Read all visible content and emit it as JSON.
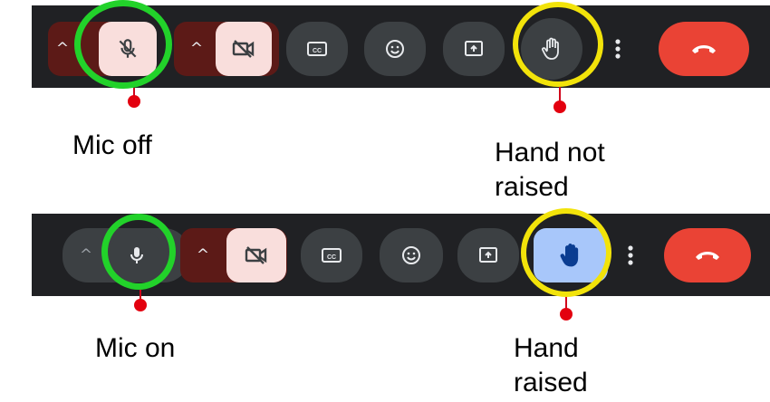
{
  "toolbar_top": {
    "mic": {
      "state": "off",
      "icon": "mic-off-icon"
    },
    "camera": {
      "state": "off",
      "icon": "camera-off-icon"
    },
    "captions": {
      "icon": "closed-captions-icon"
    },
    "reactions": {
      "icon": "emoji-icon"
    },
    "present": {
      "icon": "present-screen-icon"
    },
    "raise_hand": {
      "state": "not raised",
      "icon": "hand-icon"
    },
    "more": {
      "icon": "more-vert-icon"
    },
    "leave": {
      "icon": "end-call-icon",
      "color": "#ea4335"
    }
  },
  "toolbar_bottom": {
    "mic": {
      "state": "on",
      "icon": "mic-icon"
    },
    "camera": {
      "state": "off",
      "icon": "camera-off-icon"
    },
    "captions": {
      "icon": "closed-captions-icon"
    },
    "reactions": {
      "icon": "emoji-icon"
    },
    "present": {
      "icon": "present-screen-icon"
    },
    "raise_hand": {
      "state": "raised",
      "icon": "hand-icon",
      "color": "#a8c7fa"
    },
    "more": {
      "icon": "more-vert-icon"
    },
    "leave": {
      "icon": "end-call-icon",
      "color": "#ea4335"
    }
  },
  "annotations": {
    "mic_off": "Mic off",
    "hand_not_raised_line1": "Hand not",
    "hand_not_raised_line2": "raised",
    "mic_on": "Mic on",
    "hand_raised_line1": "Hand",
    "hand_raised_line2": "raised"
  },
  "colors": {
    "mic_ring": "#22d22a",
    "hand_ring": "#f2e30a",
    "pointer": "#e3000f"
  }
}
